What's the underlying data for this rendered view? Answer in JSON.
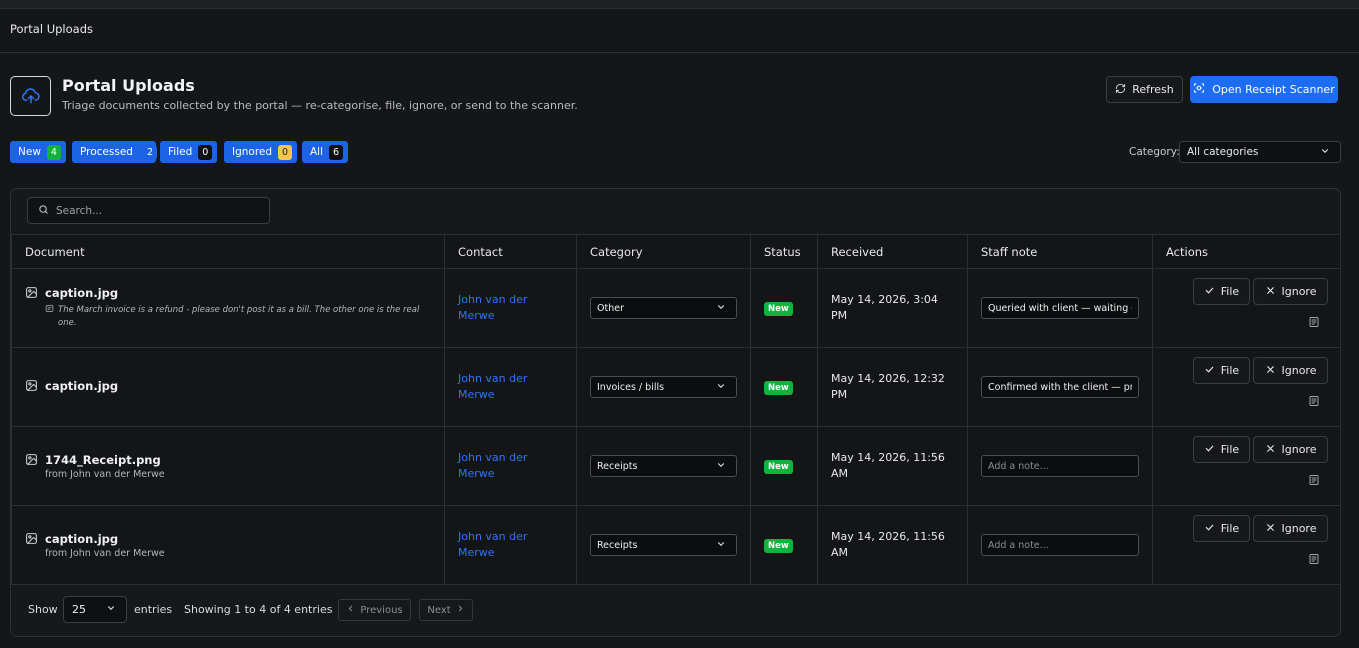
{
  "breadcrumb": "Portal Uploads",
  "header": {
    "title": "Portal Uploads",
    "subtitle": "Triage documents collected by the portal — re-categorise, file, ignore, or send to the scanner.",
    "refresh_label": "Refresh",
    "scanner_label": "Open Receipt Scanner"
  },
  "filters": [
    {
      "label": "New",
      "count": "4"
    },
    {
      "label": "Processed",
      "count": "2"
    },
    {
      "label": "Filed",
      "count": "0"
    },
    {
      "label": "Ignored",
      "count": "0"
    },
    {
      "label": "All",
      "count": "6"
    }
  ],
  "category_filter": {
    "label": "Category:",
    "value": "All categories"
  },
  "search": {
    "placeholder": "Search..."
  },
  "columns": [
    "Document",
    "Contact",
    "Category",
    "Status",
    "Received",
    "Staff note",
    "Actions"
  ],
  "rows": [
    {
      "name": "caption.jpg",
      "subtitle": "",
      "note": "The March invoice is a refund - please don't post it as a bill. The other one is the real one.",
      "contact": "John van der Merwe",
      "category": "Other",
      "status": "New",
      "received": "May 14, 2026, 3:04 PM",
      "staff_note": "Queried with client — waiting on reply",
      "staff_note_placeholder": "Add a note..."
    },
    {
      "name": "caption.jpg",
      "subtitle": "",
      "note": "",
      "contact": "John van der Merwe",
      "category": "Invoices / bills",
      "status": "New",
      "received": "May 14, 2026, 12:32 PM",
      "staff_note": "Confirmed with the client — proceed",
      "staff_note_placeholder": "Add a note..."
    },
    {
      "name": "1744_Receipt.png",
      "subtitle": "from John van der Merwe",
      "note": "",
      "contact": "John van der Merwe",
      "category": "Receipts",
      "status": "New",
      "received": "May 14, 2026, 11:56 AM",
      "staff_note": "",
      "staff_note_placeholder": "Add a note..."
    },
    {
      "name": "caption.jpg",
      "subtitle": "from John van der Merwe",
      "note": "",
      "contact": "John van der Merwe",
      "category": "Receipts",
      "status": "New",
      "received": "May 14, 2026, 11:56 AM",
      "staff_note": "",
      "staff_note_placeholder": "Add a note..."
    }
  ],
  "row_actions": {
    "file_label": "File",
    "ignore_label": "Ignore"
  },
  "footer": {
    "show_label": "Show",
    "page_length": "25",
    "entries_label": "entries",
    "info": "Showing 1 to 4 of 4 entries",
    "previous_label": "Previous",
    "next_label": "Next"
  },
  "colors": {
    "accent": "#1d6df2",
    "badge_new": "#12b33c",
    "count_new": "#12b33c",
    "count_ignored": "#f2c94c",
    "count_default": "#0f1012",
    "link": "#2f74f5"
  }
}
